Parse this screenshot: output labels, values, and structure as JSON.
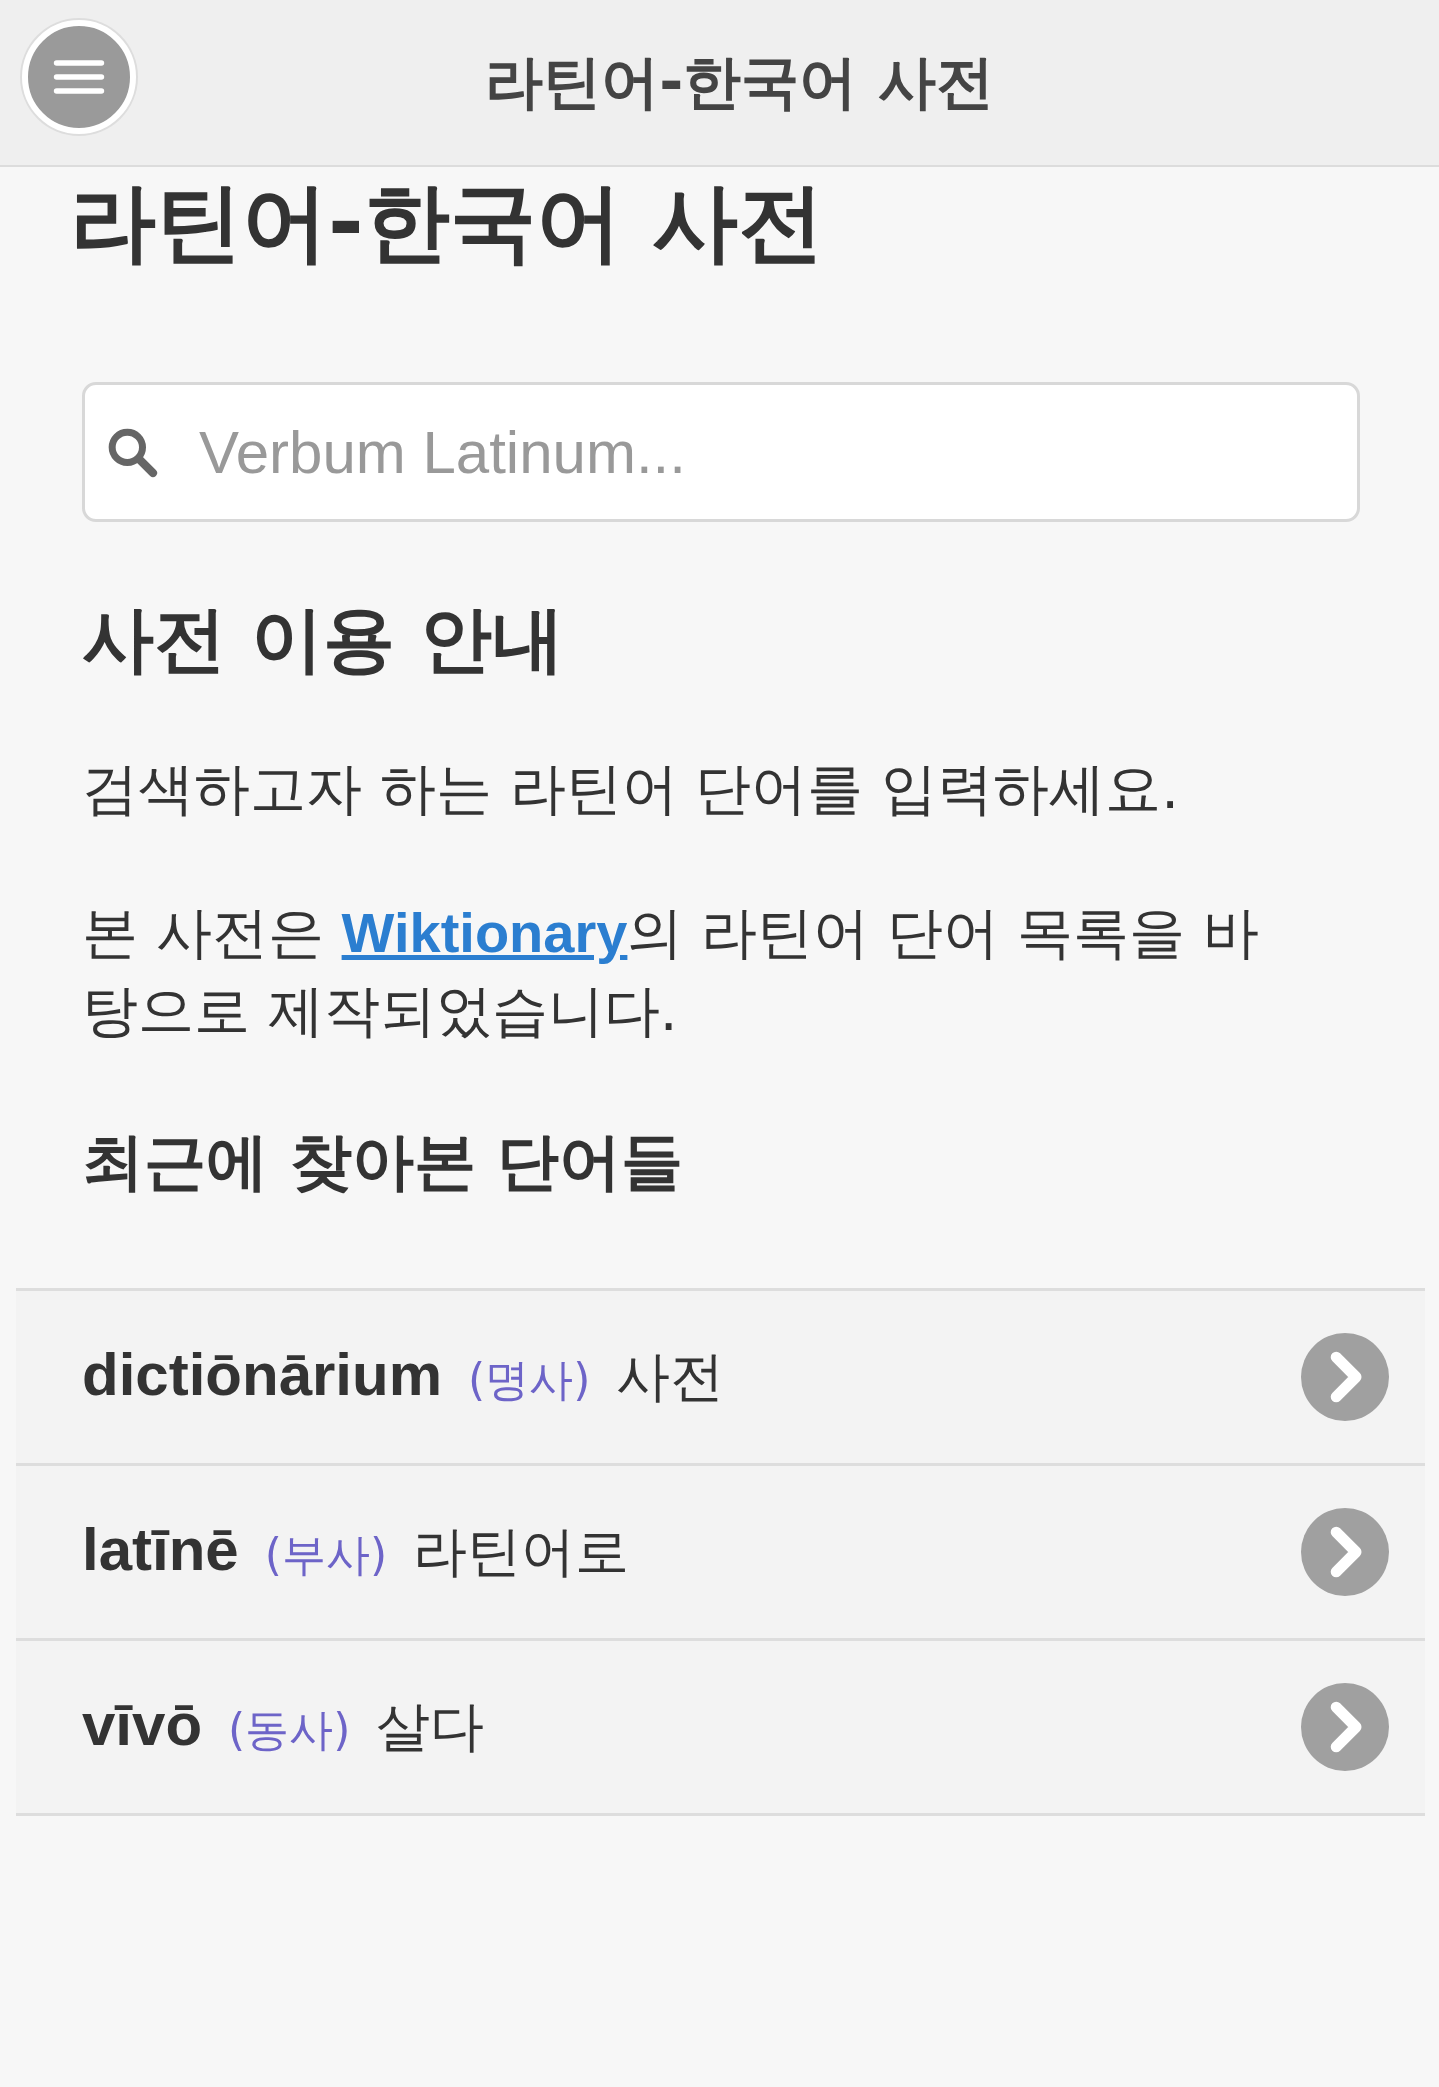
{
  "header": {
    "title": "라틴어-한국어 사전"
  },
  "page_title": "라틴어-한국어 사전",
  "search": {
    "placeholder": "Verbum Latinum..."
  },
  "guide": {
    "heading": "사전 이용 안내",
    "paragraphs": [
      {
        "parts": [
          {
            "kind": "text",
            "text": "검색하고자 하는 라틴어 단어를 입력하세요."
          }
        ]
      },
      {
        "parts": [
          {
            "kind": "text",
            "text": "본 사전은 "
          },
          {
            "kind": "link",
            "text": "Wiktionary"
          },
          {
            "kind": "text",
            "text": "의 라틴어 단어 목록을 바탕으로 제작되었습니다."
          }
        ]
      }
    ]
  },
  "recent": {
    "heading": "최근에 찾아본 단어들",
    "items": [
      {
        "word": "dictiōnārium",
        "pos": "(명사)",
        "meaning": "사전"
      },
      {
        "word": "latīnē",
        "pos": "(부사)",
        "meaning": "라틴어로"
      },
      {
        "word": "vīvō",
        "pos": "(동사)",
        "meaning": "살다"
      }
    ]
  }
}
